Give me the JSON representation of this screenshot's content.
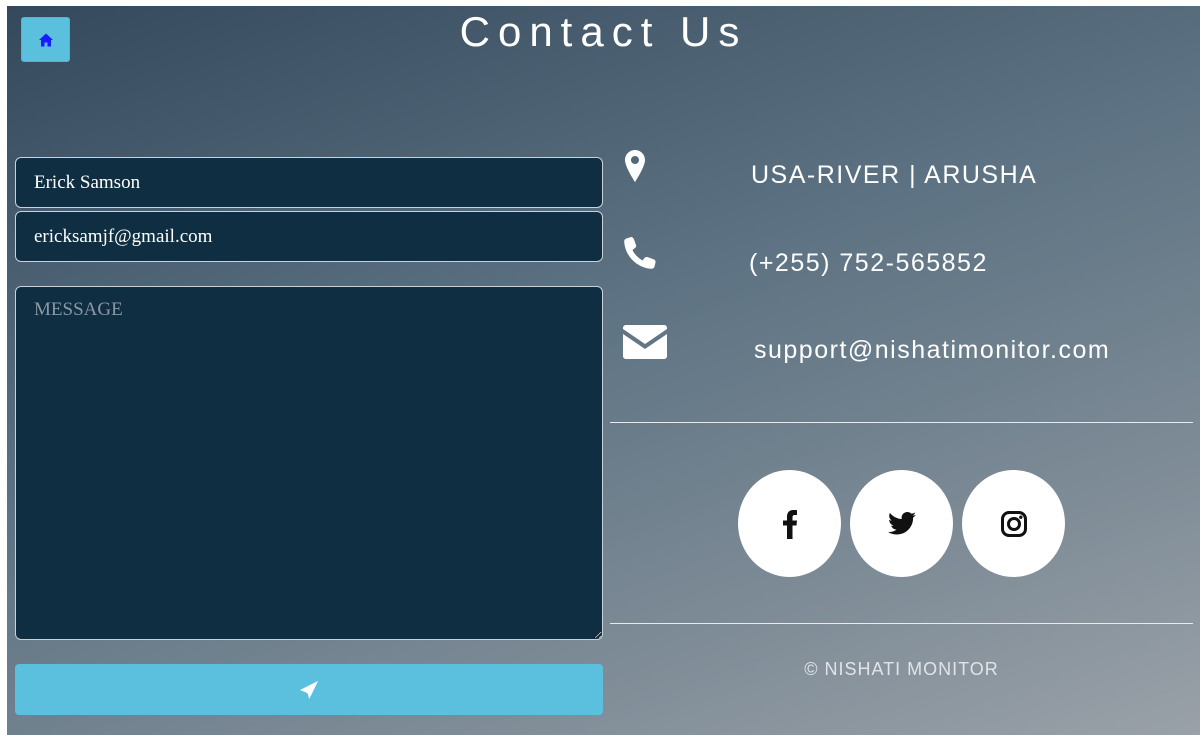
{
  "header": {
    "title": "Contact Us",
    "home_icon": "home-icon"
  },
  "form": {
    "name_value": "Erick Samson",
    "email_value": "ericksamjf@gmail.com",
    "message_placeholder": "MESSAGE",
    "message_value": "",
    "send_icon": "paper-plane-icon"
  },
  "contact": {
    "location": {
      "icon": "map-marker-icon",
      "text": "USA-RIVER | ARUSHA"
    },
    "phone": {
      "icon": "phone-icon",
      "text": "(+255) 752-565852"
    },
    "email": {
      "icon": "envelope-icon",
      "text": "support@nishatimonitor.com"
    }
  },
  "social": [
    {
      "name": "facebook",
      "icon": "facebook-icon"
    },
    {
      "name": "twitter",
      "icon": "twitter-icon"
    },
    {
      "name": "instagram",
      "icon": "instagram-icon"
    }
  ],
  "footer": {
    "copyright": "© NISHATI MONITOR"
  },
  "colors": {
    "accent": "#5bc0de",
    "field_bg": "#0f2e42",
    "text": "#ffffff"
  }
}
